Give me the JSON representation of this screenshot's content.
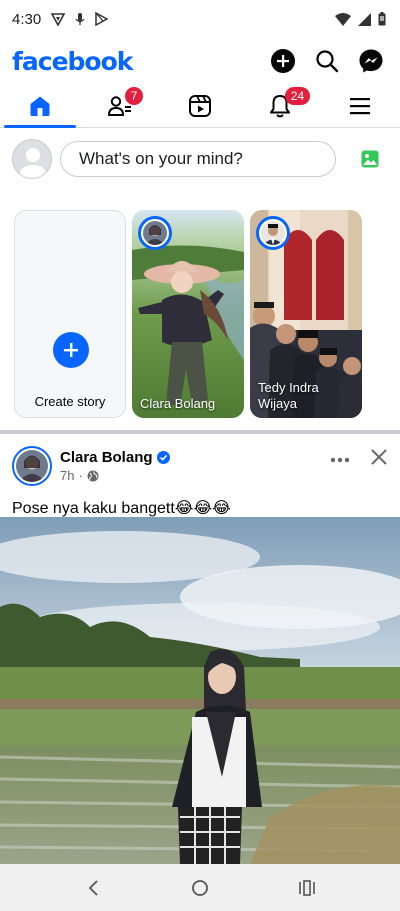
{
  "status_bar": {
    "time": "4:30"
  },
  "header": {
    "brand": "facebook"
  },
  "tabs": [
    {
      "name": "home",
      "badge": ""
    },
    {
      "name": "friends",
      "badge": "7"
    },
    {
      "name": "video",
      "badge": ""
    },
    {
      "name": "notifications",
      "badge": "24"
    },
    {
      "name": "menu",
      "badge": ""
    }
  ],
  "composer": {
    "prompt": "What's on your mind?"
  },
  "stories": {
    "create_label": "Create story",
    "items": [
      {
        "name": "Clara Bolang"
      },
      {
        "name": "Tedy Indra Wijaya"
      }
    ]
  },
  "post": {
    "author": "Clara Bolang",
    "time": "7h",
    "text": "Pose nya kaku bangett😂😂😂"
  },
  "colors": {
    "accent": "#0866ff",
    "badge": "#e41e3f",
    "photo_icon": "#34c759"
  }
}
